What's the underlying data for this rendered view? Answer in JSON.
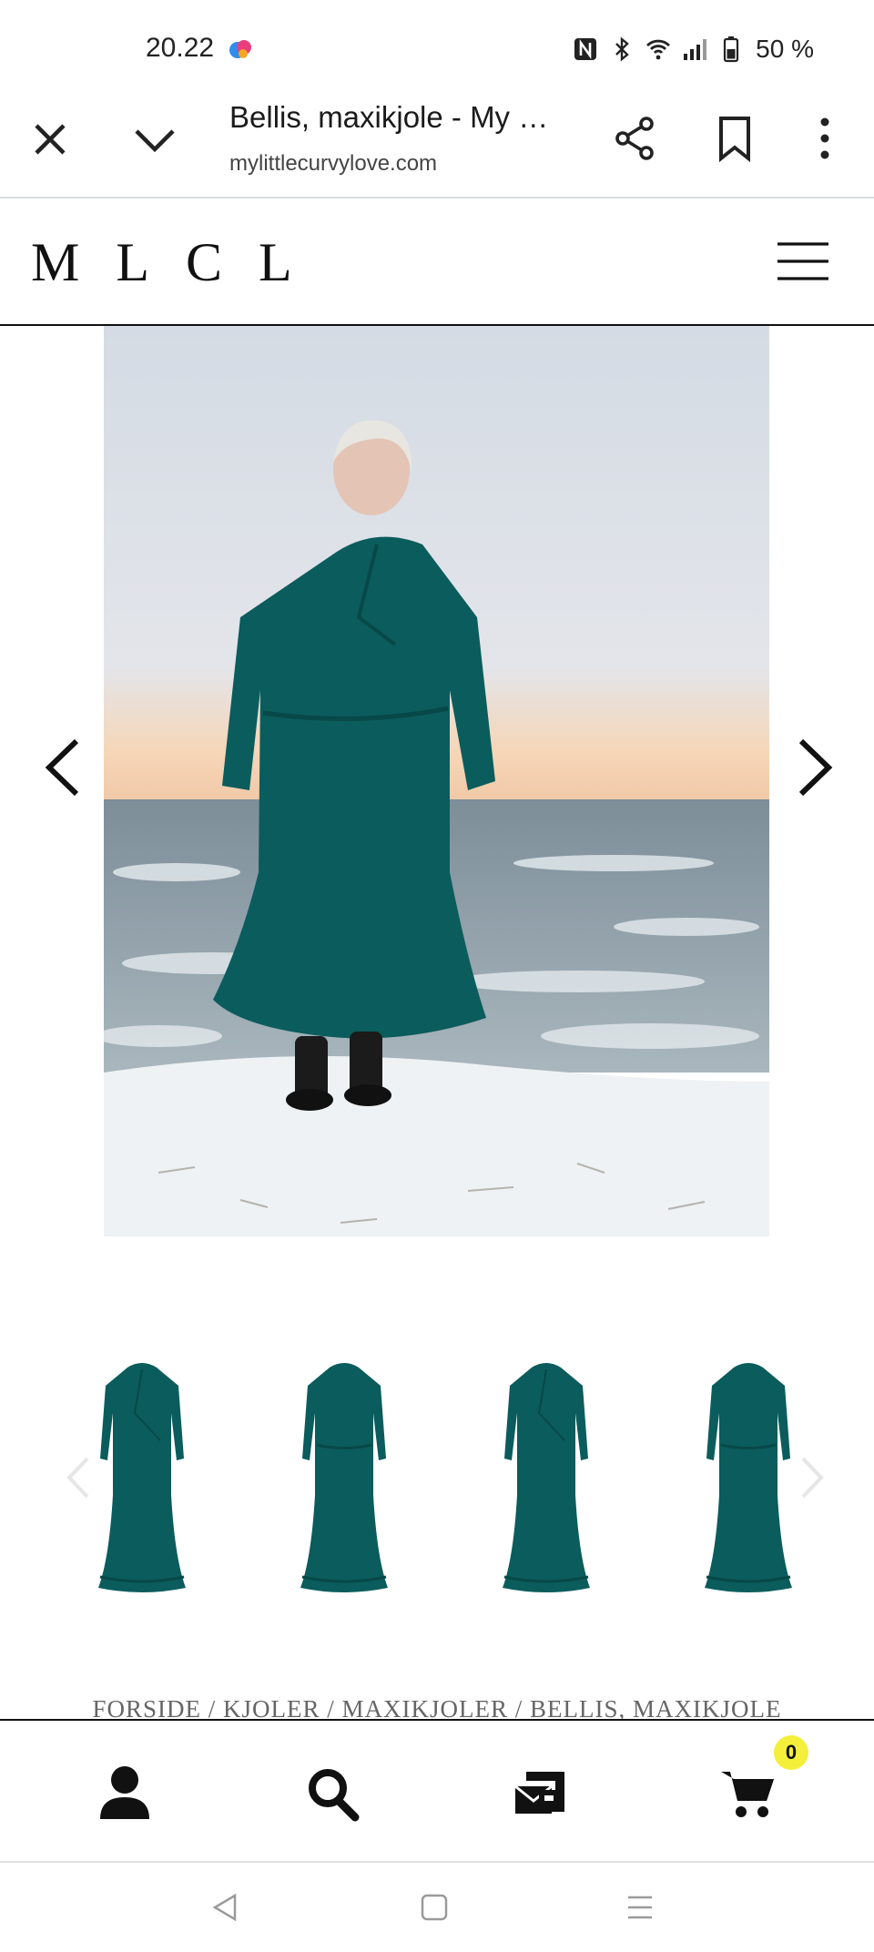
{
  "status_bar": {
    "time": "20.22",
    "battery": "50 %",
    "icons": [
      "nfc-icon",
      "bluetooth-icon",
      "wifi-icon",
      "signal-icon",
      "battery-icon"
    ]
  },
  "browser": {
    "title": "Bellis, maxikjole - My …",
    "url": "mylittlecurvylove.com"
  },
  "site": {
    "logo": "MLCL"
  },
  "hero": {
    "description_icon": "model-photo"
  },
  "breadcrumb": "FORSIDE / KJOLER / MAXIKJOLER / BELLIS, MAXIKJOLE",
  "cart": {
    "count": "0"
  },
  "colors": {
    "dress": "#0b5c5c",
    "badge": "#f3ef3a",
    "sky": "#d7dde6",
    "sea": "#8a9aa5"
  }
}
